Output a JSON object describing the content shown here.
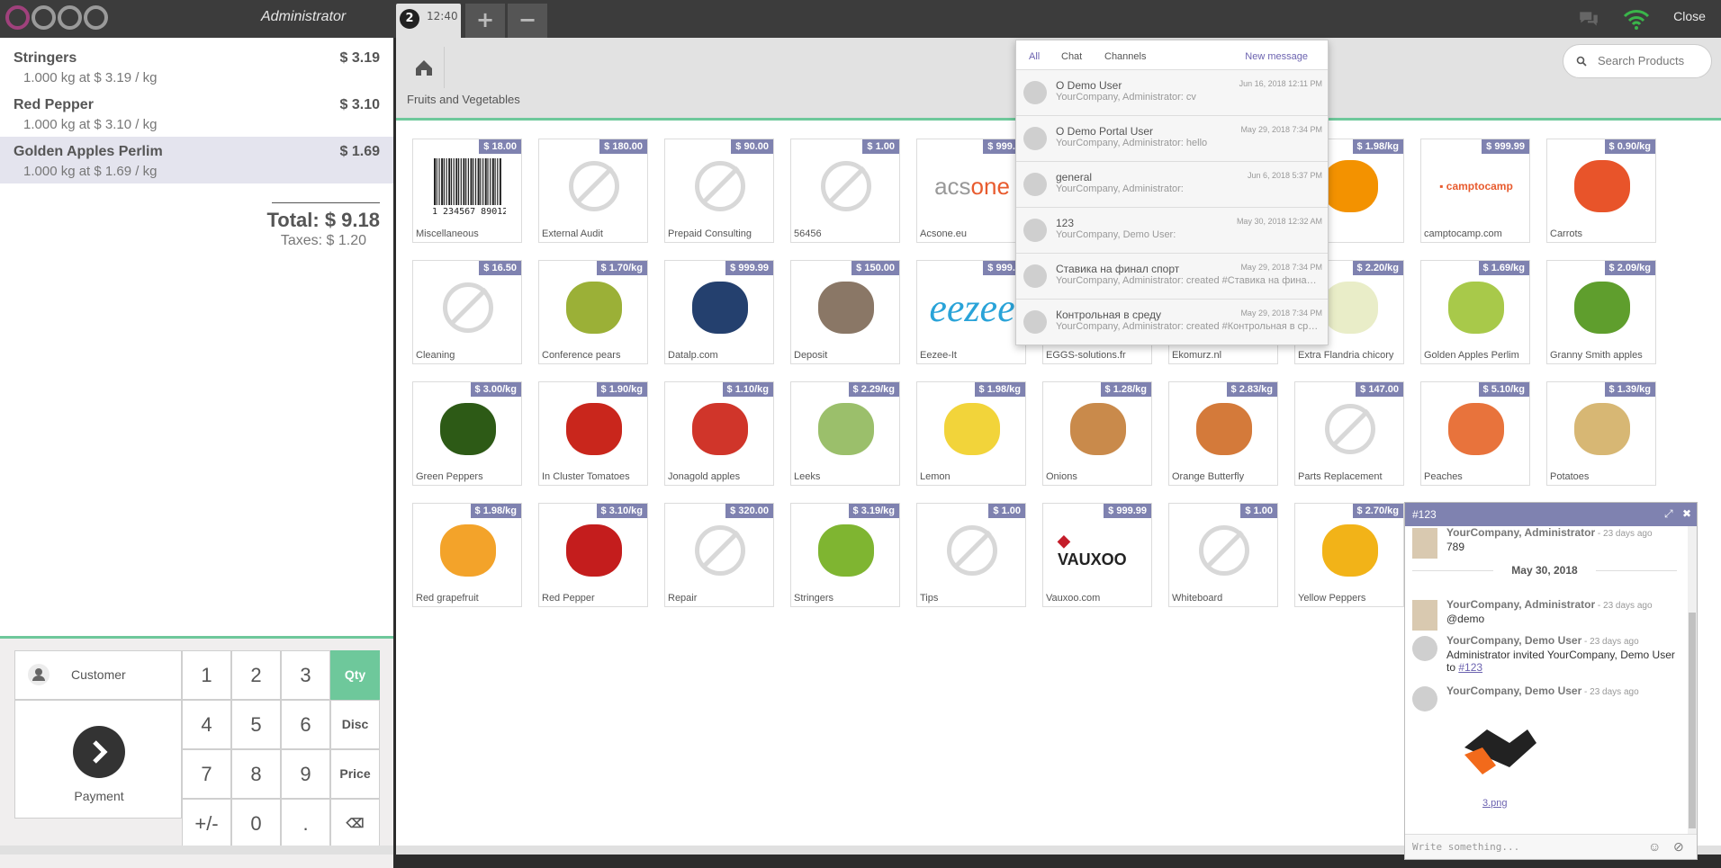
{
  "header": {
    "user": "Administrator",
    "order_number": "2",
    "order_time": "12:40",
    "add_order": "+",
    "remove_order": "−",
    "close": "Close"
  },
  "order": {
    "lines": [
      {
        "name": "Stringers",
        "price": "$ 3.19",
        "info": "1.000 kg at $ 3.19 / kg"
      },
      {
        "name": "Red Pepper",
        "price": "$ 3.10",
        "info": "1.000 kg at $ 3.10 / kg"
      },
      {
        "name": "Golden Apples Perlim",
        "price": "$ 1.69",
        "info": "1.000 kg at $ 1.69 / kg"
      }
    ],
    "total": "Total: $ 9.18",
    "taxes": "Taxes: $ 1.20"
  },
  "pad": {
    "customer": "Customer",
    "payment": "Payment",
    "keys": [
      "1",
      "2",
      "3",
      "Qty",
      "4",
      "5",
      "6",
      "Disc",
      "7",
      "8",
      "9",
      "Price",
      "+/-",
      "0",
      ".",
      "⌫"
    ]
  },
  "products_header": {
    "category": "Fruits and Vegetables",
    "search_placeholder": "Search Products"
  },
  "products": [
    {
      "name": "Miscellaneous",
      "price": "$ 18.00",
      "img": "barcode"
    },
    {
      "name": "External Audit",
      "price": "$ 180.00",
      "img": "none"
    },
    {
      "name": "Prepaid Consulting",
      "price": "$ 90.00",
      "img": "none"
    },
    {
      "name": "56456",
      "price": "$ 1.00",
      "img": "none"
    },
    {
      "name": "Acsone.eu",
      "price": "$ 999.9",
      "img": "acsone"
    },
    {
      "name": "",
      "price": "",
      "img": "hidden"
    },
    {
      "name": "",
      "price": "",
      "img": "hidden"
    },
    {
      "name": "ranges",
      "price": "$ 1.98/kg",
      "img": "#f39200"
    },
    {
      "name": "camptocamp.com",
      "price": "$ 999.99",
      "img": "camptocamp"
    },
    {
      "name": "Carrots",
      "price": "$ 0.90/kg",
      "img": "#e8542a"
    },
    {
      "name": "Cleaning",
      "price": "$ 16.50",
      "img": "none"
    },
    {
      "name": "Conference pears",
      "price": "$ 1.70/kg",
      "img": "#9bb037"
    },
    {
      "name": "Datalp.com",
      "price": "$ 999.99",
      "img": "#24406e"
    },
    {
      "name": "Deposit",
      "price": "$ 150.00",
      "img": "#8a7766"
    },
    {
      "name": "Eezee-It",
      "price": "$ 999.9",
      "img": "eezee"
    },
    {
      "name": "EGGS-solutions.fr",
      "price": "",
      "img": "hidden"
    },
    {
      "name": "Ekomurz.nl",
      "price": "",
      "img": "hidden"
    },
    {
      "name": "Extra Flandria chicory",
      "price": "$ 2.20/kg",
      "img": "#e9edc8"
    },
    {
      "name": "Golden Apples Perlim",
      "price": "$ 1.69/kg",
      "img": "#a8c94a"
    },
    {
      "name": "Granny Smith apples",
      "price": "$ 2.09/kg",
      "img": "#5f9e2d"
    },
    {
      "name": "Green Peppers",
      "price": "$ 3.00/kg",
      "img": "#2d5a16"
    },
    {
      "name": "In Cluster Tomatoes",
      "price": "$ 1.90/kg",
      "img": "#c9261c"
    },
    {
      "name": "Jonagold apples",
      "price": "$ 1.10/kg",
      "img": "#d0352a"
    },
    {
      "name": "Leeks",
      "price": "$ 2.29/kg",
      "img": "#9bbf6b"
    },
    {
      "name": "Lemon",
      "price": "$ 1.98/kg",
      "img": "#f2d43a"
    },
    {
      "name": "Onions",
      "price": "$ 1.28/kg",
      "img": "#c98a4b"
    },
    {
      "name": "Orange Butterfly",
      "price": "$ 2.83/kg",
      "img": "#d47a3a"
    },
    {
      "name": "Parts Replacement",
      "price": "$ 147.00",
      "img": "none"
    },
    {
      "name": "Peaches",
      "price": "$ 5.10/kg",
      "img": "#e8733c"
    },
    {
      "name": "Potatoes",
      "price": "$ 1.39/kg",
      "img": "#d7b774"
    },
    {
      "name": "Red grapefruit",
      "price": "$ 1.98/kg",
      "img": "#f3a32a"
    },
    {
      "name": "Red Pepper",
      "price": "$ 3.10/kg",
      "img": "#c41d1d"
    },
    {
      "name": "Repair",
      "price": "$ 320.00",
      "img": "none"
    },
    {
      "name": "Stringers",
      "price": "$ 3.19/kg",
      "img": "#7fb531"
    },
    {
      "name": "Tips",
      "price": "$ 1.00",
      "img": "none"
    },
    {
      "name": "Vauxoo.com",
      "price": "$ 999.99",
      "img": "vauxoo"
    },
    {
      "name": "Whiteboard",
      "price": "$ 1.00",
      "img": "none"
    },
    {
      "name": "Yellow Peppers",
      "price": "$ 2.70/kg",
      "img": "#f2b318"
    }
  ],
  "messaging": {
    "tabs": [
      "All",
      "Chat",
      "Channels"
    ],
    "new_message": "New message",
    "items": [
      {
        "title": "O Demo User",
        "date": "Jun 16, 2018 12:11 PM",
        "snippet": "YourCompany, Administrator: cv"
      },
      {
        "title": "O Demo Portal User",
        "date": "May 29, 2018 7:34 PM",
        "snippet": "YourCompany, Administrator: hello"
      },
      {
        "title": "general",
        "date": "Jun 6, 2018 5:37 PM",
        "snippet": "YourCompany, Administrator:"
      },
      {
        "title": "123",
        "date": "May 30, 2018 12:32 AM",
        "snippet": "YourCompany, Demo User:"
      },
      {
        "title": "Ставика на финал спорт",
        "date": "May 29, 2018 7:34 PM",
        "snippet": "YourCompany, Administrator: created #Ставика на финал спорт"
      },
      {
        "title": "Контрольная в среду",
        "date": "May 29, 2018 7:34 PM",
        "snippet": "YourCompany, Administrator: created #Контрольная в среду"
      }
    ]
  },
  "chat": {
    "title": "#123",
    "date_sep": "May 30, 2018",
    "messages": [
      {
        "author": "YourCompany, Administrator",
        "ago": " - 23 days ago",
        "text": "789"
      },
      {
        "author": "YourCompany, Administrator",
        "ago": " - 23 days ago",
        "text": "@demo"
      },
      {
        "author": "YourCompany, Demo User",
        "ago": " - 23 days ago",
        "text": "Administrator invited YourCompany, Demo User to ",
        "link": "#123"
      },
      {
        "author": "YourCompany, Demo User",
        "ago": " - 23 days ago",
        "attachment": "3.png"
      }
    ],
    "input_placeholder": "Write something..."
  },
  "colors": {
    "accent": "#6ec89b",
    "price_tag": "#7f82b0",
    "link": "#6c63b0"
  }
}
